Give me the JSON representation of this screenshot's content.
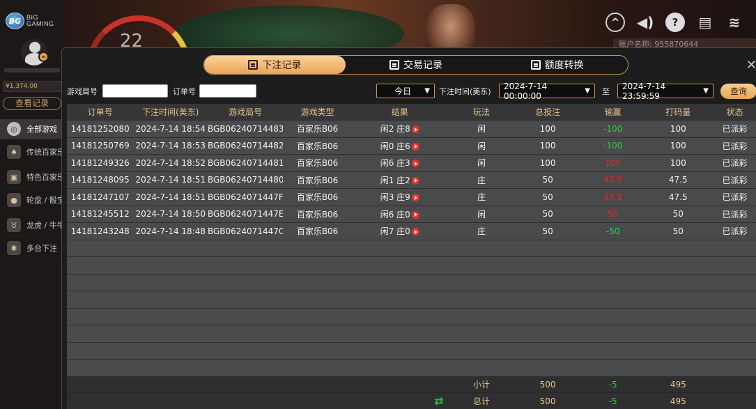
{
  "scene": {
    "timer": "22"
  },
  "brand": {
    "badge": "BG",
    "line1": "BIG",
    "line2": "GAMING"
  },
  "account_strip": "账户名称: 955870644",
  "sidebar": {
    "balance": "¥1,374.00",
    "view_records": "查看记录",
    "categories": [
      {
        "label": "全部游戏",
        "icon": "chip-icon"
      },
      {
        "label": "传统百家乐",
        "icon": "cards-icon"
      },
      {
        "label": "特色百家乐",
        "icon": "card-icon"
      },
      {
        "label": "轮盘 / 骰宝",
        "icon": "roulette-icon"
      },
      {
        "label": "龙虎 / 牛牛",
        "icon": "bull-icon"
      },
      {
        "label": "多台下注",
        "icon": "multi-icon"
      }
    ]
  },
  "tabs": [
    {
      "label": "下注记录",
      "active": true
    },
    {
      "label": "交易记录",
      "active": false
    },
    {
      "label": "额度转换",
      "active": false
    }
  ],
  "filters": {
    "round_label": "游戏局号",
    "order_label": "订单号",
    "period": "今日",
    "time_label": "下注时间(美东)",
    "start": "2024-7-14 00:00:00",
    "to": "至",
    "end": "2024-7-14 23:59:59",
    "query": "查询"
  },
  "table": {
    "headers": [
      "订单号",
      "下注时间(美东)",
      "游戏局号",
      "游戏类型",
      "结果",
      "玩法",
      "总投注",
      "输赢",
      "打码量",
      "状态"
    ],
    "rows": [
      {
        "order": "14181252080",
        "time": "2024-7-14 18:54",
        "round": "BGB06240714483",
        "type": "百家乐B06",
        "result": "闲2 庄8",
        "play": "闲",
        "bet": "100",
        "winloss": "-100",
        "wl_sign": "neg",
        "turnover": "100",
        "status": "已派彩"
      },
      {
        "order": "14181250769",
        "time": "2024-7-14 18:53",
        "round": "BGB06240714482",
        "type": "百家乐B06",
        "result": "闲0 庄6",
        "play": "闲",
        "bet": "100",
        "winloss": "-100",
        "wl_sign": "neg",
        "turnover": "100",
        "status": "已派彩"
      },
      {
        "order": "14181249326",
        "time": "2024-7-14 18:52",
        "round": "BGB06240714481",
        "type": "百家乐B06",
        "result": "闲6 庄3",
        "play": "闲",
        "bet": "100",
        "winloss": "100",
        "wl_sign": "pos",
        "turnover": "100",
        "status": "已派彩"
      },
      {
        "order": "14181248095",
        "time": "2024-7-14 18:51",
        "round": "BGB06240714480",
        "type": "百家乐B06",
        "result": "闲1 庄2",
        "play": "庄",
        "bet": "50",
        "winloss": "47.5",
        "wl_sign": "pos",
        "turnover": "47.5",
        "status": "已派彩"
      },
      {
        "order": "14181247107",
        "time": "2024-7-14 18:51",
        "round": "BGB0624071447F",
        "type": "百家乐B06",
        "result": "闲3 庄9",
        "play": "庄",
        "bet": "50",
        "winloss": "47.5",
        "wl_sign": "pos",
        "turnover": "47.5",
        "status": "已派彩"
      },
      {
        "order": "14181245512",
        "time": "2024-7-14 18:50",
        "round": "BGB0624071447E",
        "type": "百家乐B06",
        "result": "闲6 庄0",
        "play": "闲",
        "bet": "50",
        "winloss": "50",
        "wl_sign": "pos",
        "turnover": "50",
        "status": "已派彩"
      },
      {
        "order": "14181243248",
        "time": "2024-7-14 18:48",
        "round": "BGB0624071447C",
        "type": "百家乐B06",
        "result": "闲7 庄0",
        "play": "庄",
        "bet": "50",
        "winloss": "-50",
        "wl_sign": "neg",
        "turnover": "50",
        "status": "已派彩"
      }
    ],
    "empty_rows": 8
  },
  "summary": {
    "subtotal": {
      "label": "小计",
      "bet": "500",
      "winloss": "-5",
      "turnover": "495"
    },
    "total": {
      "label": "总计",
      "bet": "500",
      "winloss": "-5",
      "turnover": "495"
    }
  },
  "colors": {
    "accent": "#e9a55a",
    "loss": "#2fcf3a",
    "win": "#e12b23"
  }
}
